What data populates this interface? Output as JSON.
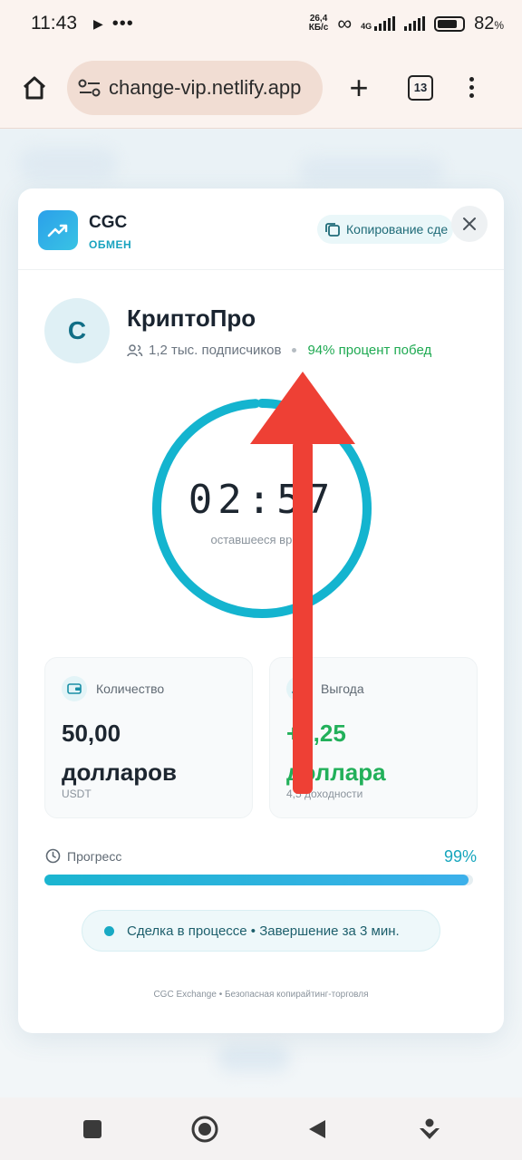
{
  "status_bar": {
    "time": "11:43",
    "net_speed_top": "26,4",
    "net_speed_bottom": "КБ/с",
    "network_type": "4G",
    "battery_percent": "82"
  },
  "browser": {
    "url": "change-vip.netlify.app",
    "tab_count": "13"
  },
  "card": {
    "brand": {
      "name": "CGC",
      "subtitle": "ОБМЕН"
    },
    "copy_button_label": "Копирование сде",
    "trader": {
      "initial": "C",
      "name": "КриптоПро",
      "subscribers": "1,2 тыс. подписчиков",
      "win_rate": "94% процент побед"
    },
    "timer": {
      "value": "02:57",
      "label": "оставшееся время",
      "ring_progress": 0.99
    },
    "stats": {
      "amount": {
        "label": "Количество",
        "value": "50,00 долларов",
        "foot": "USDT"
      },
      "profit": {
        "label": "Выгода",
        "value": "+2,25 доллара",
        "foot": "4,5 доходности"
      }
    },
    "progress": {
      "label": "Прогресс",
      "percent_text": "99%",
      "value": 0.99
    },
    "status_text": "Сделка в процессе • Завершение за 3 мин.",
    "footer": "CGC Exchange • Безопасная копирайтинг-торговля"
  },
  "colors": {
    "accent": "#19a3bf",
    "success": "#22b05a",
    "overlay_arrow": "#ee4035"
  }
}
